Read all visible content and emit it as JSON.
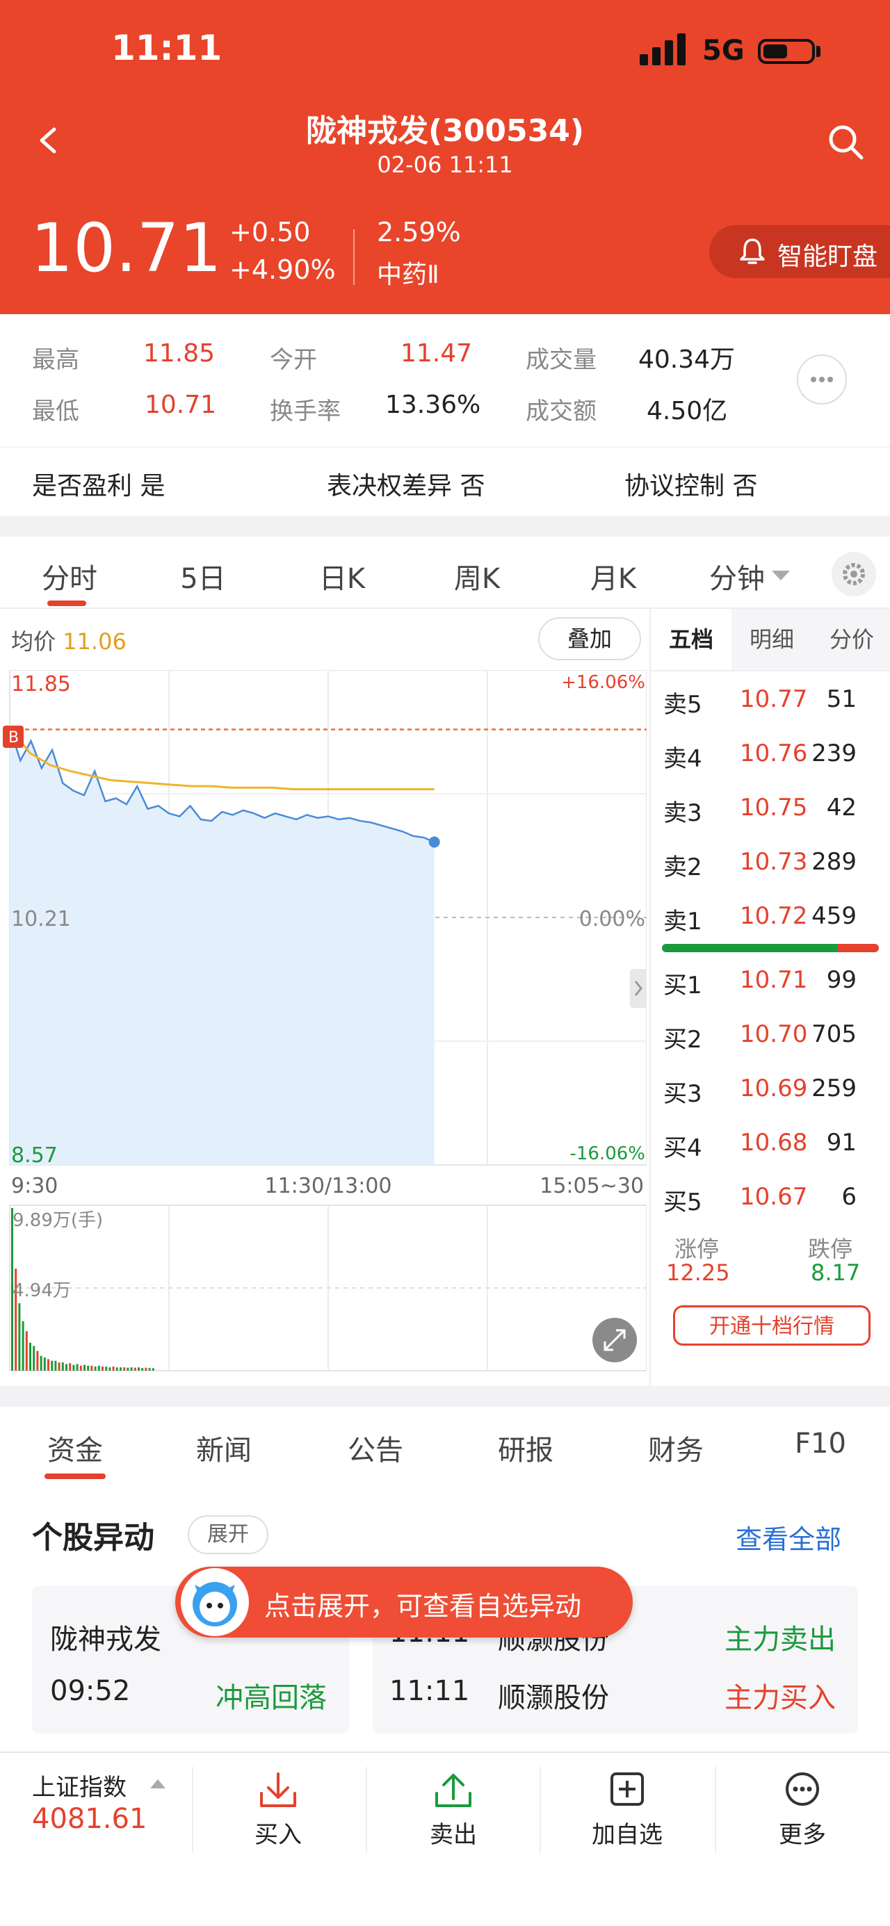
{
  "status_bar": {
    "time": "11:11",
    "network": "5G"
  },
  "header": {
    "title": "陇神戎发(300534)",
    "subtitle": "02-06 11:11",
    "price": "10.71",
    "change": "+0.50",
    "change_pct": "+4.90%",
    "turnover_pct": "2.59%",
    "sector": "中药Ⅱ",
    "watch_button": "智能盯盘"
  },
  "quote": {
    "high_label": "最高",
    "high": "11.85",
    "open_label": "今开",
    "open": "11.47",
    "volume_label": "成交量",
    "volume": "40.34万",
    "low_label": "最低",
    "low": "10.71",
    "turnover_label": "换手率",
    "turnover": "13.36%",
    "amount_label": "成交额",
    "amount": "4.50亿"
  },
  "flags": [
    {
      "label": "是否盈利",
      "value": "是"
    },
    {
      "label": "表决权差异",
      "value": "否"
    },
    {
      "label": "协议控制",
      "value": "否"
    }
  ],
  "chart_tabs": [
    "分时",
    "5日",
    "日K",
    "周K",
    "月K",
    "分钟"
  ],
  "chart_info": {
    "avg_label": "均价",
    "avg_value": "11.06",
    "overlay_button": "叠加"
  },
  "chart_data": {
    "type": "line",
    "title": "",
    "y_high_label": "11.85",
    "y_mid_label": "10.21",
    "y_low_label": "8.57",
    "pct_high_label": "+16.06%",
    "pct_mid_label": "0.00%",
    "pct_low_label": "-16.06%",
    "x_labels": [
      "9:30",
      "11:30/13:00",
      "15:05~30"
    ],
    "ylim": [
      8.57,
      11.85
    ],
    "prev_close": 10.21,
    "series": [
      {
        "values": [
          11.47,
          11.25,
          11.38,
          11.2,
          11.32,
          11.1,
          11.05,
          11.02,
          11.18,
          10.98,
          11.0,
          10.96,
          11.08,
          10.93,
          10.95,
          10.9,
          10.88,
          10.95,
          10.86,
          10.85,
          10.91,
          10.89,
          10.92,
          10.9,
          10.87,
          10.9,
          10.88,
          10.86,
          10.89,
          10.87,
          10.88,
          10.86,
          10.87,
          10.85,
          10.84,
          10.82,
          10.8,
          10.78,
          10.75,
          10.74,
          10.71
        ]
      },
      {
        "values": [
          11.47,
          11.3,
          11.22,
          11.18,
          11.15,
          11.12,
          11.11,
          11.1,
          11.09,
          11.08,
          11.08,
          11.07,
          11.07,
          11.07,
          11.06,
          11.06,
          11.06,
          11.06,
          11.06,
          11.06,
          11.06,
          11.06
        ]
      }
    ],
    "volume_labels": [
      "9.89万(手)",
      "4.94万"
    ],
    "volume_ylim": [
      0,
      9.89
    ],
    "volume_values": [
      9.89,
      6.2,
      4.1,
      3.0,
      2.4,
      1.7,
      1.5,
      1.2,
      0.9,
      0.8,
      0.7,
      0.6,
      0.6,
      0.5,
      0.5,
      0.4,
      0.45,
      0.35,
      0.4,
      0.3,
      0.35,
      0.3,
      0.3,
      0.25,
      0.3,
      0.25,
      0.25,
      0.2,
      0.25,
      0.2,
      0.2,
      0.2,
      0.18,
      0.2,
      0.18,
      0.2,
      0.16,
      0.18,
      0.16,
      0.15
    ]
  },
  "order_book": {
    "tabs": [
      "五档",
      "明细",
      "分价"
    ],
    "asks": [
      {
        "label": "卖5",
        "price": "10.77",
        "vol": "51"
      },
      {
        "label": "卖4",
        "price": "10.76",
        "vol": "239"
      },
      {
        "label": "卖3",
        "price": "10.75",
        "vol": "42"
      },
      {
        "label": "卖2",
        "price": "10.73",
        "vol": "289"
      },
      {
        "label": "卖1",
        "price": "10.72",
        "vol": "459"
      }
    ],
    "bids": [
      {
        "label": "买1",
        "price": "10.71",
        "vol": "99"
      },
      {
        "label": "买2",
        "price": "10.70",
        "vol": "705"
      },
      {
        "label": "买3",
        "price": "10.69",
        "vol": "259"
      },
      {
        "label": "买4",
        "price": "10.68",
        "vol": "91"
      },
      {
        "label": "买5",
        "price": "10.67",
        "vol": "6"
      }
    ],
    "limit_up_label": "涨停",
    "limit_up": "12.25",
    "limit_down_label": "跌停",
    "limit_down": "8.17",
    "depth_button": "开通十档行情"
  },
  "section_tabs": [
    "资金",
    "新闻",
    "公告",
    "研报",
    "财务",
    "F10"
  ],
  "anomaly": {
    "title": "个股异动",
    "expand": "展开",
    "view_all": "查看全部",
    "tooltip": "点击展开，可查看自选异动",
    "left": {
      "stock": "陇神戎发",
      "time": "09:52",
      "event": "冲高回落"
    },
    "right": [
      {
        "time": "11:11",
        "stock": "顺灏股份",
        "event": "主力卖出"
      },
      {
        "time": "11:11",
        "stock": "顺灏股份",
        "event": "主力买入"
      }
    ]
  },
  "bottom_bar": {
    "index_name": "上证指数",
    "index_value": "4081.61",
    "buy": "买入",
    "sell": "卖出",
    "add": "加自选",
    "more": "更多"
  }
}
